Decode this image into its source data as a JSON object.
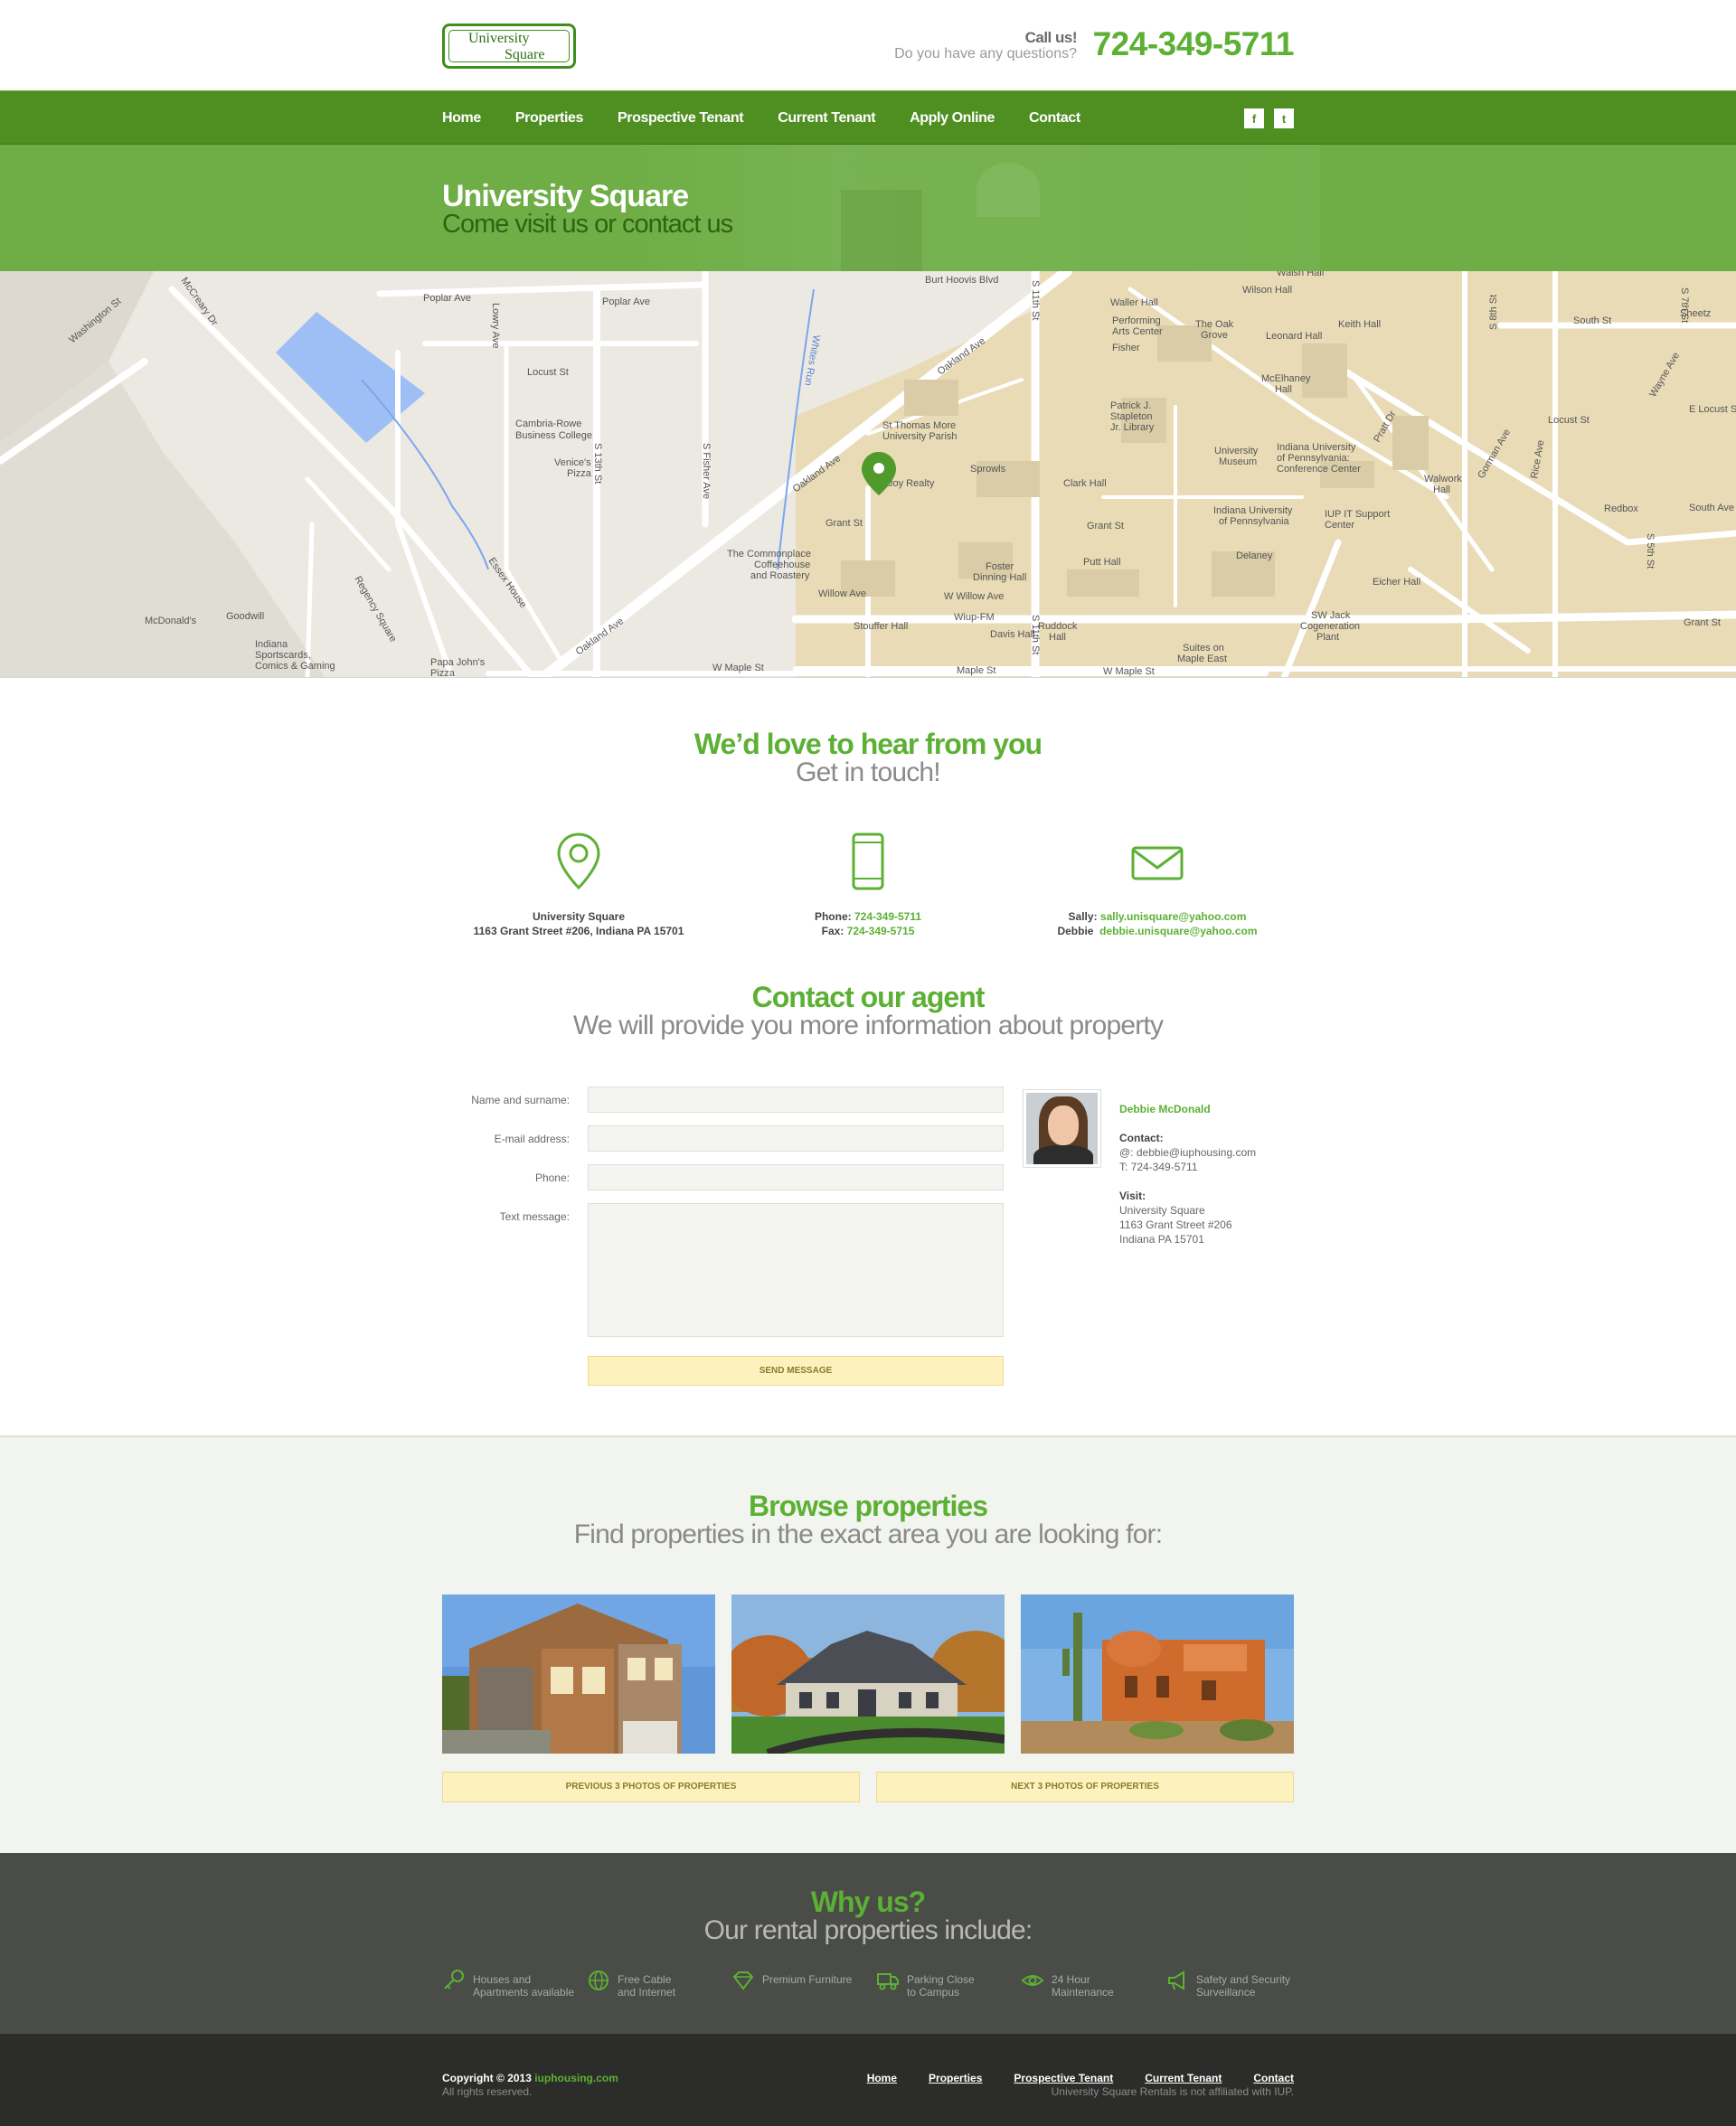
{
  "header": {
    "logo_line1": "University",
    "logo_line2": "Square",
    "call_title": "Call us!",
    "call_sub": "Do you have any questions?",
    "phone": "724-349-5711"
  },
  "nav": {
    "items": [
      "Home",
      "Properties",
      "Prospective Tenant",
      "Current Tenant",
      "Apply Online",
      "Contact"
    ],
    "social": [
      "f",
      "t"
    ]
  },
  "hero": {
    "title": "University Square",
    "subtitle": "Come visit us or contact us"
  },
  "map": {
    "labels": [
      "Poplar Ave",
      "Poplar Ave",
      "Washington St",
      "McCreary Dr",
      "Locust St",
      "Lowry Ave",
      "S 13th St",
      "S Fisher Ave",
      "Whites Run",
      "Oakland Ave",
      "Oakland Ave",
      "Oakland Ave",
      "Grant St",
      "Grant St",
      "Grant St",
      "Willow Ave",
      "W Willow Ave",
      "W Maple St",
      "Maple St",
      "W Maple St",
      "S 11th St",
      "S 11th St",
      "South St",
      "Locust St",
      "S 7th St",
      "S 8th St",
      "Wayne Ave",
      "E Locust St",
      "South Ave",
      "Rice Ave",
      "Pratt Dr",
      "Gorman Ave",
      "S 5th St",
      "Regency Square",
      "Essex House",
      "Burt Hoovis Blvd",
      "Cambria-Rowe Business College",
      "Venice's Pizza",
      "St Thomas More University Parish",
      "Joy Realty",
      "The Commonplace Coffeehouse and Roastery",
      "Sprowls",
      "Clark Hall",
      "Patrick J. Stapleton Jr. Library",
      "University Museum",
      "Indiana University of Pennsylvania: Conference Center",
      "Indiana University of Pennsylvania",
      "IUP IT Support Center",
      "Putt Hall",
      "Foster Dinning Hall",
      "Stouffer Hall",
      "Wiup-FM",
      "Davis Hall",
      "Ruddock Hall",
      "Delaney",
      "Eicher Hall",
      "SW Jack Cogeneration Plant",
      "Suites on Maple East",
      "Walwork Hall",
      "Keith Hall",
      "Leonard Hall",
      "McElhaney Hall",
      "The Oak Grove",
      "Waller Hall",
      "Performing Arts Center",
      "Fisher",
      "Wilson Hall",
      "Walsh Hall",
      "Sheetz",
      "Redbox",
      "McDonald's",
      "Goodwill",
      "Indiana Sportscards, Comics & Gaming",
      "Papa John's Pizza"
    ]
  },
  "hear": {
    "title": "We’d love to hear from you",
    "subtitle": "Get in touch!"
  },
  "contact_info": {
    "address_name": "University Square",
    "address_line": "1163 Grant Street #206, Indiana PA 15701",
    "phone_label": "Phone:",
    "phone": "724-349-5711",
    "fax_label": "Fax:",
    "fax": "724-349-5715",
    "email1_label": "Sally:",
    "email1": "sally.unisquare@yahoo.com",
    "email2_label": "Debbie",
    "email2": "debbie.unisquare@yahoo.com"
  },
  "agent_section": {
    "title": "Contact our agent",
    "subtitle": "We will provide you more information about property"
  },
  "form": {
    "name_label": "Name and surname:",
    "email_label": "E-mail address:",
    "phone_label": "Phone:",
    "message_label": "Text message:",
    "send_label": "SEND MESSAGE"
  },
  "agent": {
    "name": "Debbie McDonald",
    "contact_heading": "Contact:",
    "email": "@: debbie@iuphousing.com",
    "phone": "T: 724-349-5711",
    "visit_heading": "Visit:",
    "visit_line1": "University Square",
    "visit_line2": "1163 Grant Street #206",
    "visit_line3": "Indiana PA 15701"
  },
  "browse": {
    "title": "Browse properties",
    "subtitle": "Find properties in the exact area you are looking for:",
    "prev_label": "PREVIOUS 3 PHOTOS OF PROPERTIES",
    "next_label": "NEXT 3 PHOTOS OF PROPERTIES"
  },
  "why": {
    "title": "Why us?",
    "subtitle": "Our rental properties include:",
    "features": [
      {
        "line1": "Houses and",
        "line2": "Apartments available",
        "icon": "key-icon"
      },
      {
        "line1": "Free Cable",
        "line2": "and Internet",
        "icon": "globe-icon"
      },
      {
        "line1": "Premium Furniture",
        "line2": "",
        "icon": "diamond-icon"
      },
      {
        "line1": "Parking Close",
        "line2": "to Campus",
        "icon": "truck-icon"
      },
      {
        "line1": "24 Hour",
        "line2": "Maintenance",
        "icon": "eye-icon"
      },
      {
        "line1": "Safety and Security",
        "line2": "Surveillance",
        "icon": "megaphone-icon"
      }
    ]
  },
  "footer": {
    "copyright": "Copyright © 2013",
    "site": "iuphousing.com",
    "rights": "All rights reserved.",
    "links": [
      "Home",
      "Properties",
      "Prospective Tenant",
      "Current Tenant",
      "Contact"
    ],
    "note": "University Square Rentals is not affiliated with IUP."
  },
  "colors": {
    "accent": "#5cb034",
    "nav": "#4f8f22",
    "hero": "#6fae47",
    "button": "#fdf2bd",
    "why_bg": "#4a4c48",
    "footer_bg": "#2c2d2b"
  }
}
